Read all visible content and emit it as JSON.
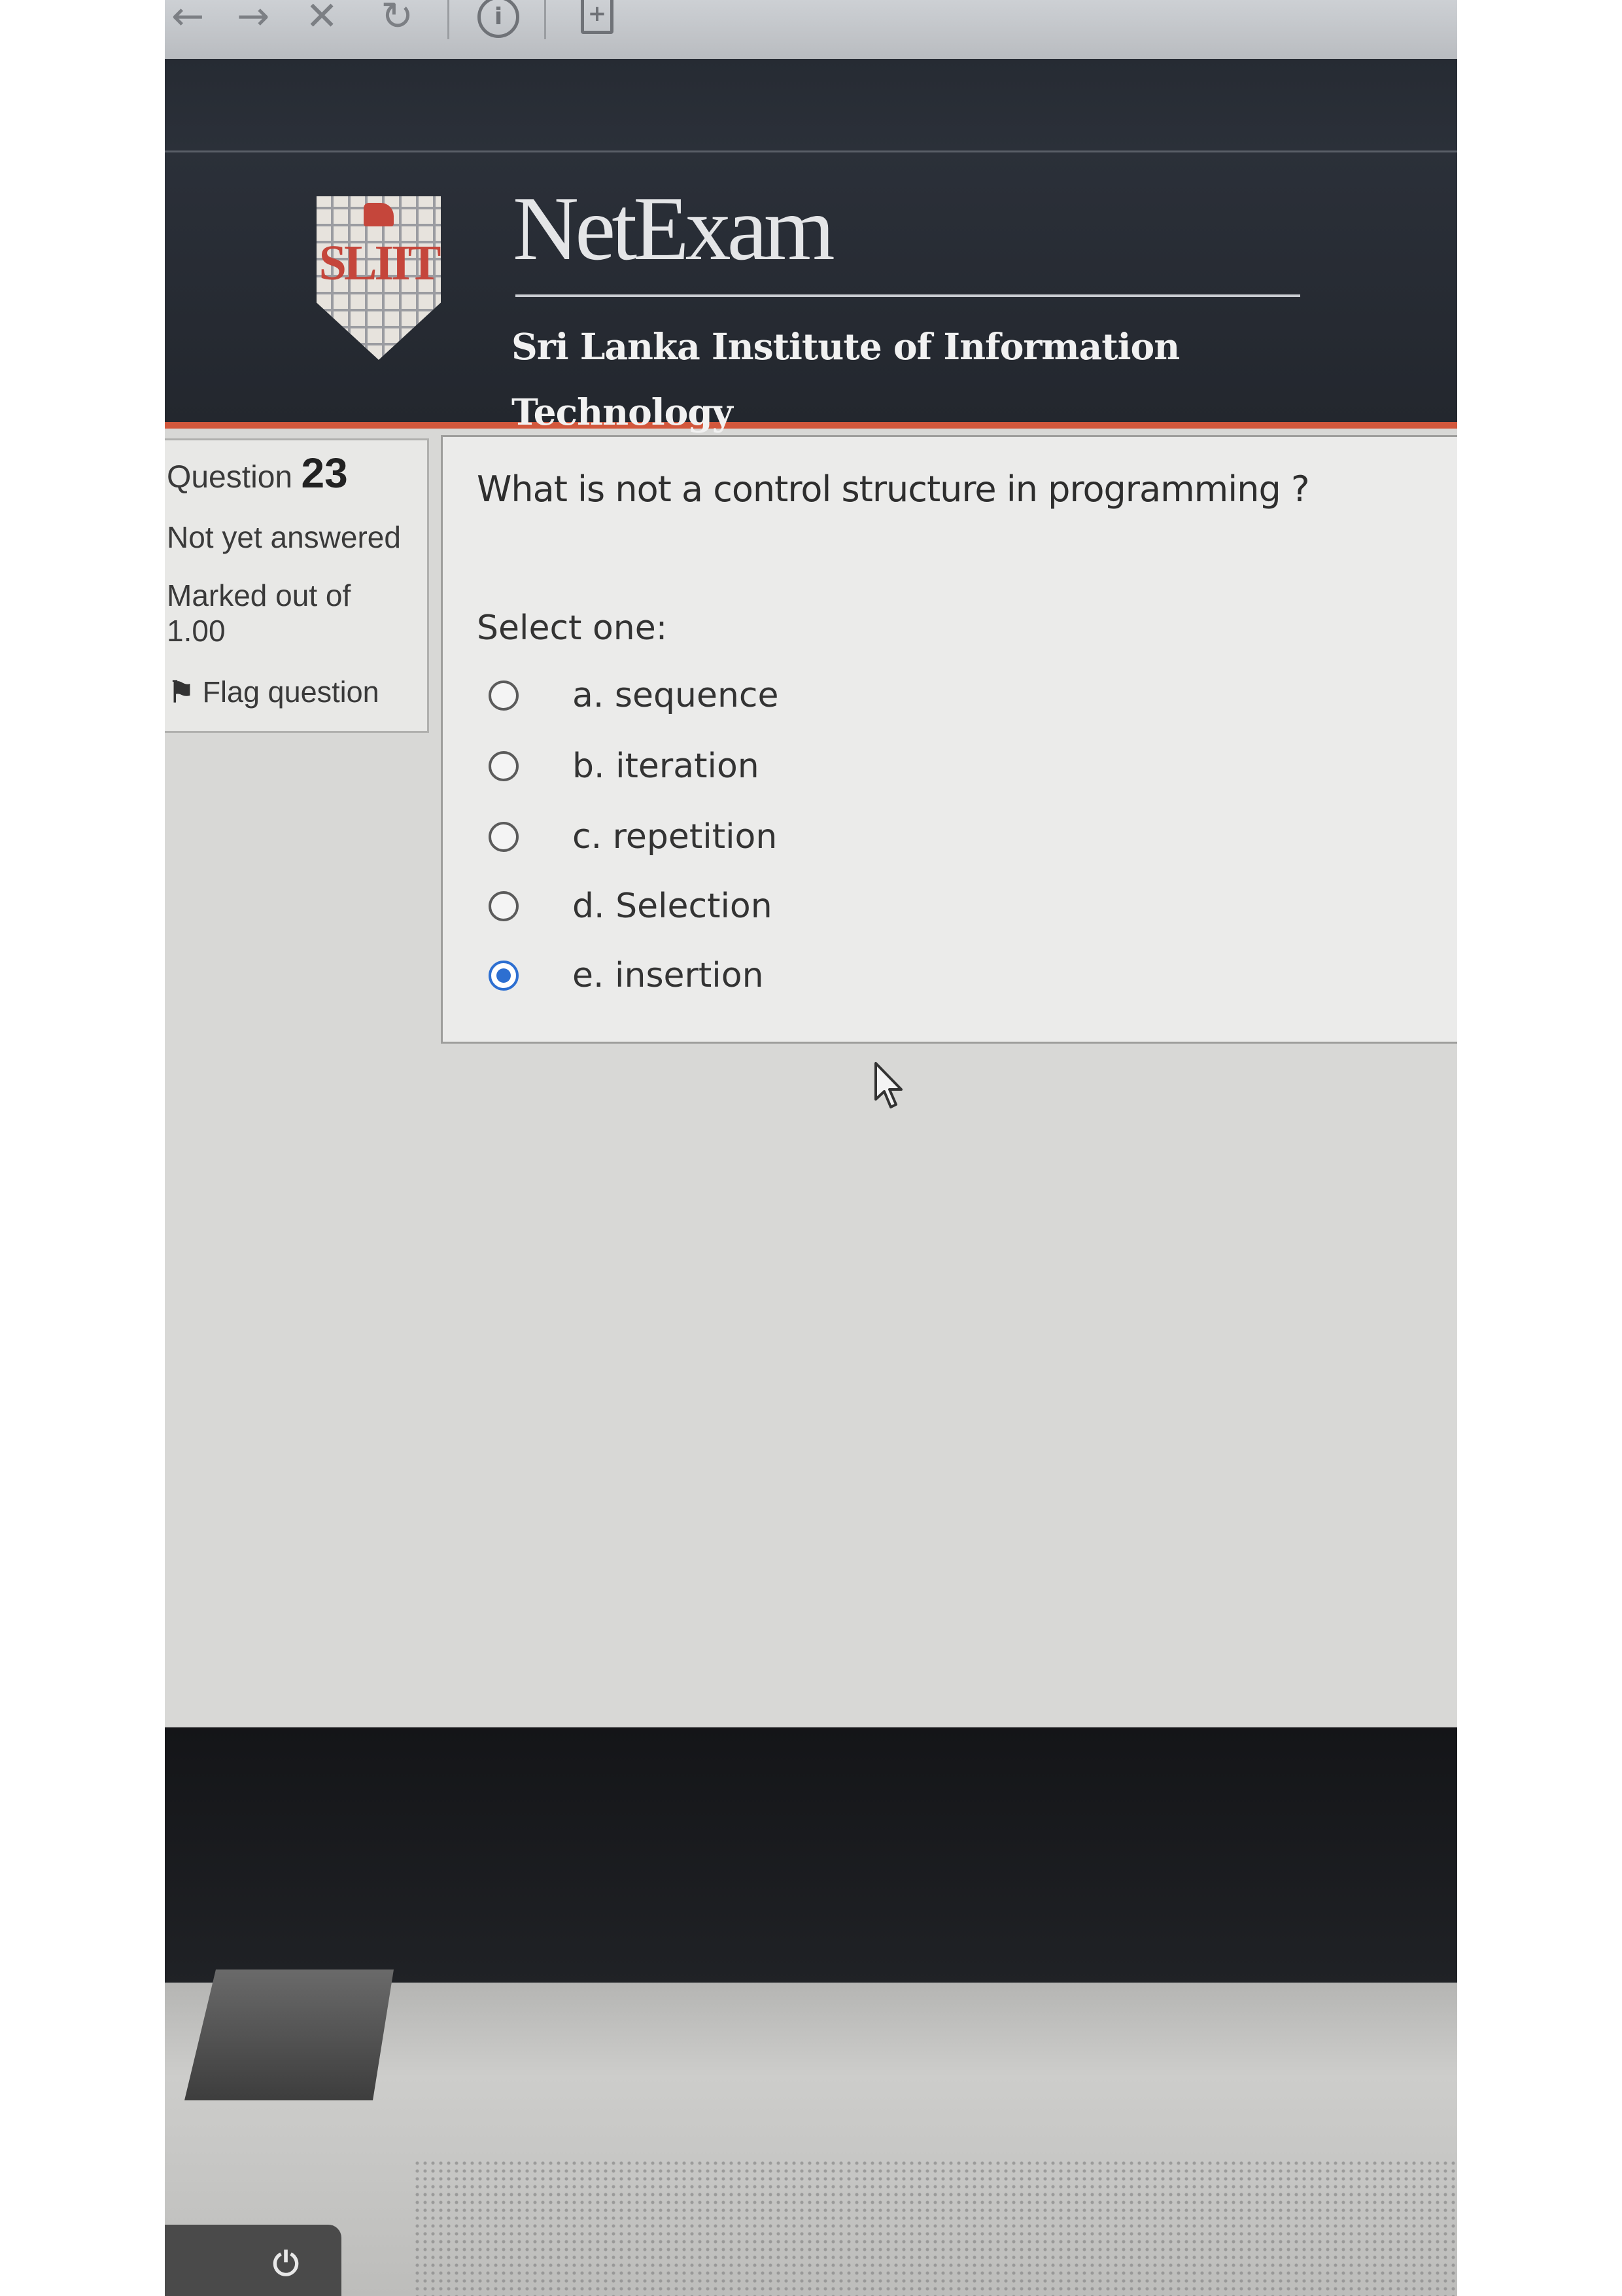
{
  "browser": {
    "icons": [
      "back-icon",
      "forward-icon",
      "stop-icon",
      "reload-icon",
      "info-icon",
      "page-icon"
    ]
  },
  "header": {
    "logo_text": "SLIIT",
    "brand_title": "NetExam",
    "subtitle": "Sri Lanka Institute of Information Technology"
  },
  "question_info": {
    "label": "Question",
    "number": "23",
    "status": "Not yet answered",
    "marked_out_of": "Marked out of 1.00",
    "flag_label": "Flag question"
  },
  "question": {
    "text": "What is not a control structure in programming ?",
    "select_prompt": "Select one:",
    "options": [
      {
        "label": "a. sequence",
        "selected": false
      },
      {
        "label": "b. iteration",
        "selected": false
      },
      {
        "label": "c. repetition",
        "selected": false
      },
      {
        "label": "d. Selection",
        "selected": false
      },
      {
        "label": "e. insertion",
        "selected": true
      }
    ]
  },
  "colors": {
    "header_bg": "#262b33",
    "accent_rule": "#d2573c",
    "radio_selected": "#2d6fd1"
  }
}
